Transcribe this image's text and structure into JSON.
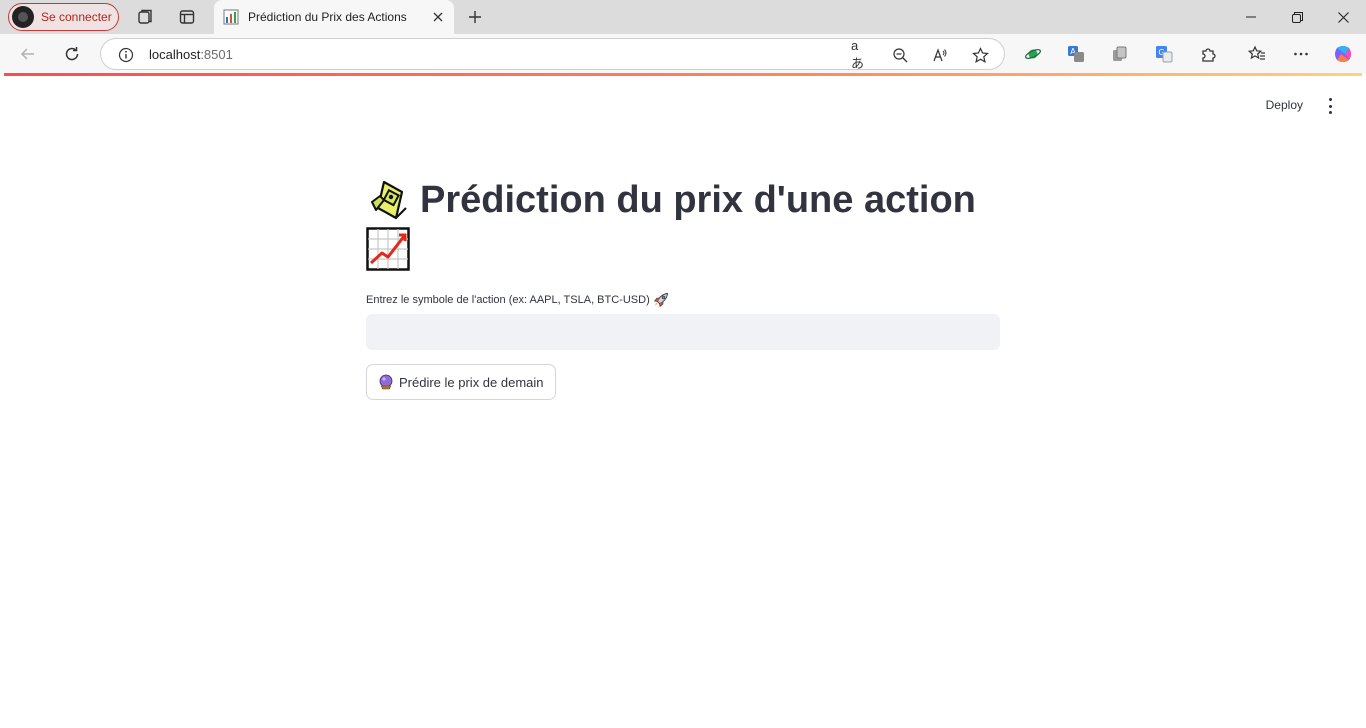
{
  "browser": {
    "profile_label": "Se connecter",
    "tab_title": "Prédiction du Prix des Actions",
    "url_host": "localhost",
    "url_port": ":8501",
    "omnibox_read_aloud": "aあ"
  },
  "header": {
    "deploy_label": "Deploy"
  },
  "main": {
    "title_line": "Prédiction du prix d'une action",
    "title_icons": [
      "crystal-ball-hand-icon",
      "chart-increasing-icon"
    ],
    "input_label": "Entrez le symbole de l'action (ex: AAPL, TSLA, BTC-USD)",
    "input_value": "",
    "button_label": "Prédire le prix de demain"
  },
  "colors": {
    "text": "#31333f",
    "input_bg": "#f0f2f6",
    "accent": "#ff4b4b",
    "profile_border": "#c23b3b"
  }
}
